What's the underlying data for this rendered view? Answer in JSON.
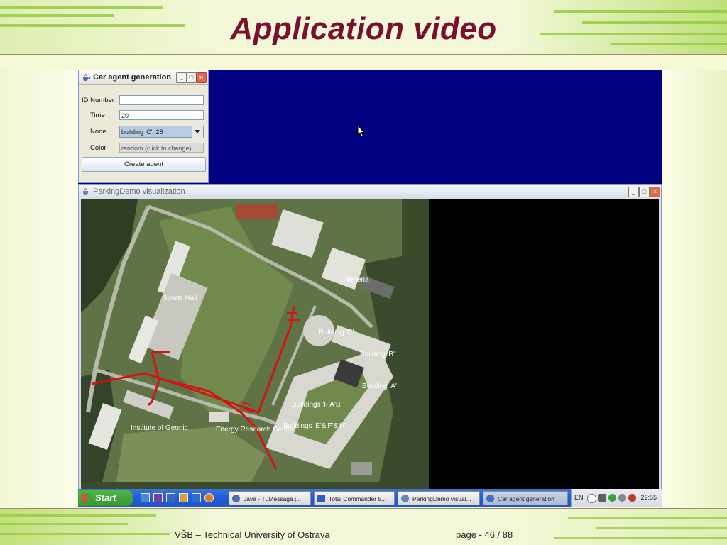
{
  "slide": {
    "title": "Application video",
    "footer_left": "VŠB – Technical University of Ostrava",
    "footer_right": "page - 46 / 88"
  },
  "car_agent_window": {
    "title": "Car agent generation",
    "fields": {
      "id_label": "ID Number",
      "id_value": "",
      "time_label": "Time",
      "time_value": "20",
      "node_label": "Node",
      "node_value": "building 'C', 28",
      "color_label": "Color",
      "color_value": "random (click to change)"
    },
    "create_button": "Create agent"
  },
  "viz_window": {
    "title": "ParkingDemo visualization",
    "map_labels": {
      "sports_hall": "Sports Hall",
      "cafeteria": "Cafeteria",
      "building_c": "Building 'C'",
      "building_b": "Building 'B'",
      "building_a": "Building 'A'",
      "buildings_fab": "Buildings 'F'A'B'",
      "institute": "Institute of Geonic",
      "energy": "Energy Research Center",
      "buildings_def": "Buildings 'E'&'F'&'H'"
    }
  },
  "taskbar": {
    "start_label": "Start",
    "tasks": [
      {
        "label": "Java - TLMessage.j..."
      },
      {
        "label": "Total Commander 5..."
      },
      {
        "label": "ParkingDemo visual..."
      },
      {
        "label": "Car agent generation"
      }
    ],
    "language": "EN",
    "clock": "22:55"
  },
  "colors": {
    "title": "#7a1030",
    "desktop": "#000080",
    "route": "#d21414"
  }
}
